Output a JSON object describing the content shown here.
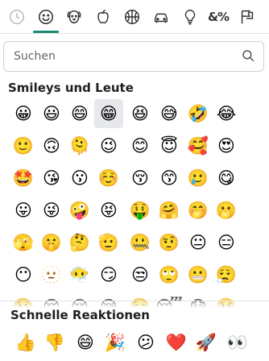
{
  "tabs": [
    {
      "name": "recent-tab",
      "icon": "clock-icon"
    },
    {
      "name": "smileys-tab",
      "icon": "smiley-icon",
      "active": true
    },
    {
      "name": "animals-tab",
      "icon": "dog-icon"
    },
    {
      "name": "food-tab",
      "icon": "apple-icon"
    },
    {
      "name": "activities-tab",
      "icon": "basketball-icon"
    },
    {
      "name": "travel-tab",
      "icon": "car-icon"
    },
    {
      "name": "objects-tab",
      "icon": "lightbulb-icon"
    },
    {
      "name": "symbols-tab",
      "icon": "symbols-icon",
      "label": "&%"
    },
    {
      "name": "flags-tab",
      "icon": "flag-icon"
    }
  ],
  "accent_color": "#1a8b73",
  "search": {
    "placeholder": "Suchen",
    "icon": "search-icon"
  },
  "section_title": "Smileys und Leute",
  "emoji_rows": [
    [
      "😀",
      "😃",
      "😄",
      "😁",
      "😆",
      "😅",
      "🤣",
      "😂"
    ],
    [
      "🙂",
      "🙃",
      "🫠",
      "😉",
      "😊",
      "😇",
      "🥰",
      "😍"
    ],
    [
      "🤩",
      "😘",
      "😗",
      "☺️",
      "😚",
      "😙",
      "🥲",
      "😋"
    ],
    [
      "😛",
      "😜",
      "🤪",
      "😝",
      "🤑",
      "🤗",
      "🤭",
      "🫢"
    ],
    [
      "🫣",
      "🤫",
      "🤔",
      "🫡",
      "🤐",
      "🤨",
      "😐",
      "😑"
    ],
    [
      "😶",
      "🫥",
      "😶‍🌫️",
      "😏",
      "😒",
      "🙄",
      "😬",
      "😮‍💨"
    ],
    [
      "🤥",
      "😌",
      "😔",
      "😪",
      "🤤",
      "😴",
      "😷",
      "🤒"
    ]
  ],
  "selected_emoji": {
    "row": 0,
    "col": 3
  },
  "quick_title": "Schnelle Reaktionen",
  "quick_reactions": [
    "👍",
    "👎",
    "😄",
    "🎉",
    "😕",
    "❤️",
    "🚀",
    "👀"
  ]
}
